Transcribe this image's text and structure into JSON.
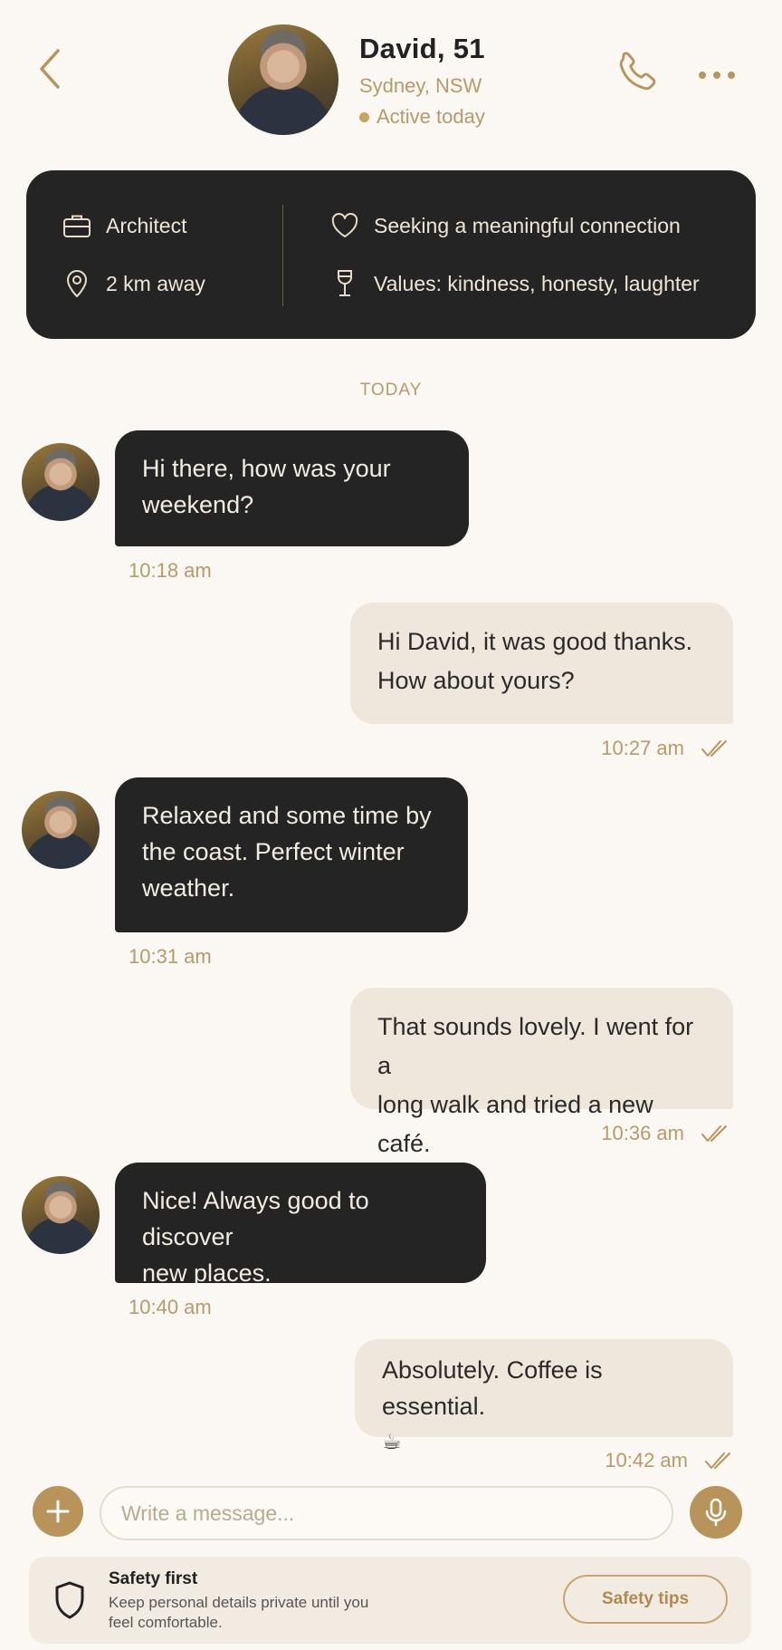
{
  "header": {
    "name": "David, 51",
    "location": "Sydney, NSW",
    "status": "Active today"
  },
  "profile": {
    "occupation": "Architect",
    "distance": "2 km away",
    "seeking": "Seeking a meaningful connection",
    "values": "Values: kindness, honesty, laughter"
  },
  "date_separator": "TODAY",
  "messages": [
    {
      "from": "them",
      "lines": [
        "Hi there, how was your",
        "weekend?"
      ],
      "time": "10:18 am"
    },
    {
      "from": "me",
      "lines": [
        "Hi David, it was good thanks.",
        "How about yours?"
      ],
      "time": "10:27 am"
    },
    {
      "from": "them",
      "lines": [
        "Relaxed and some time by",
        "the coast. Perfect winter",
        "weather."
      ],
      "time": "10:31 am"
    },
    {
      "from": "me",
      "lines": [
        "That sounds lovely. I went for a",
        "long walk and tried a new café."
      ],
      "time": "10:36 am"
    },
    {
      "from": "them",
      "lines": [
        "Nice! Always good to discover",
        "new places."
      ],
      "time": "10:40 am"
    },
    {
      "from": "me",
      "lines": [
        "Absolutely. Coffee is essential.",
        "☕"
      ],
      "time": "10:42 am"
    }
  ],
  "composer": {
    "placeholder": "Write a message..."
  },
  "safety": {
    "title": "Safety first",
    "body": "Keep personal details private until you feel comfortable.",
    "button": "Safety tips"
  },
  "colors": {
    "accent": "#b8935a",
    "dark_bubble": "#242424",
    "light_bubble": "#efe7dc",
    "background": "#fbf7f2"
  },
  "icons": [
    "back-chevron-icon",
    "phone-icon",
    "more-dots-icon",
    "briefcase-icon",
    "location-pin-icon",
    "heart-icon",
    "wine-glass-icon",
    "double-check-icon",
    "plus-icon",
    "microphone-icon",
    "shield-icon"
  ]
}
